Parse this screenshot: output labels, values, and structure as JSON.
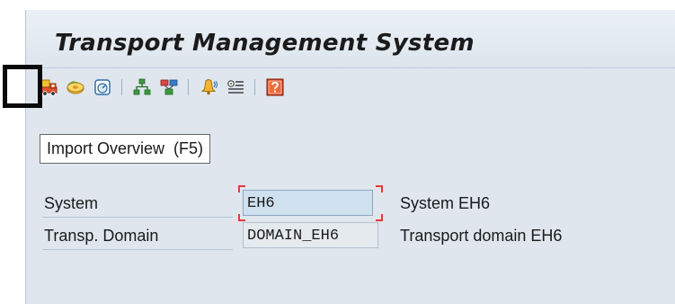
{
  "title": "Transport Management System",
  "toolbar": {
    "buttons": [
      {
        "name": "import-overview",
        "icon": "truck-icon"
      },
      {
        "name": "transport-routes",
        "icon": "tape-icon"
      },
      {
        "name": "display-alert",
        "icon": "gauge-icon"
      },
      {
        "name": "system-overview",
        "icon": "hierarchy-icon"
      },
      {
        "name": "transport-configuration",
        "icon": "network-icon"
      },
      {
        "name": "alert-monitor",
        "icon": "bell-icon"
      },
      {
        "name": "settings",
        "icon": "list-settings-icon"
      },
      {
        "name": "help",
        "icon": "help-icon"
      }
    ]
  },
  "tooltip": {
    "text": "Import Overview",
    "shortcut": "(F5)"
  },
  "form": {
    "system": {
      "label": "System",
      "value": "EH6",
      "description": "System EH6"
    },
    "domain": {
      "label": "Transp. Domain",
      "value": "DOMAIN_EH6",
      "description": "Transport domain EH6"
    }
  },
  "colors": {
    "window_bg": "#dfe6ee",
    "input_bg": "#cfe0ef",
    "focus_marker": "#e23b3b",
    "highlight_frame": "#0a0a0a"
  }
}
